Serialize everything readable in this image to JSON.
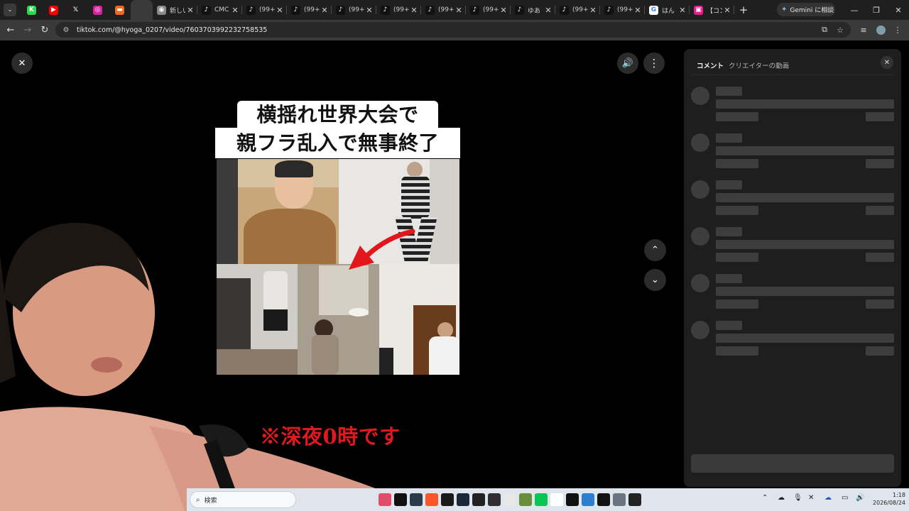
{
  "browser": {
    "url": "tiktok.com/@hyoga_0207/video/7603703992232758535",
    "gemini_label": "Gemini に相談",
    "tabs": [
      {
        "title": "",
        "icon": "k-icon",
        "color": "#2bd94b",
        "kind": "pinned",
        "glyph": "K"
      },
      {
        "title": "",
        "icon": "youtube-icon",
        "color": "#ff0000",
        "kind": "pinned",
        "glyph": "▶"
      },
      {
        "title": "",
        "icon": "x-icon",
        "color": "#1f1f1f",
        "kind": "pinned",
        "glyph": "𝕏"
      },
      {
        "title": "",
        "icon": "instagram-icon",
        "color": "#d6249f",
        "kind": "pinned",
        "glyph": "◎"
      },
      {
        "title": "",
        "icon": "orange-app-icon",
        "color": "#f26b1d",
        "kind": "pinned",
        "glyph": "▬"
      },
      {
        "title": "",
        "icon": "blank-tab-icon",
        "color": "#3a3a3a",
        "kind": "active",
        "glyph": ""
      },
      {
        "title": "新しい",
        "icon": "chrome-icon",
        "color": "#888888",
        "kind": "normal",
        "glyph": "◉"
      },
      {
        "title": "CMC",
        "icon": "tiktok-icon",
        "color": "#111111",
        "kind": "normal",
        "glyph": "♪"
      },
      {
        "title": "(99+",
        "icon": "tiktok-icon",
        "color": "#111111",
        "kind": "normal",
        "glyph": "♪"
      },
      {
        "title": "(99+",
        "icon": "tiktok-icon",
        "color": "#111111",
        "kind": "normal",
        "glyph": "♪"
      },
      {
        "title": "(99+",
        "icon": "tiktok-icon",
        "color": "#111111",
        "kind": "normal",
        "glyph": "♪"
      },
      {
        "title": "(99+",
        "icon": "tiktok-icon",
        "color": "#111111",
        "kind": "normal",
        "glyph": "♪"
      },
      {
        "title": "(99+",
        "icon": "tiktok-icon",
        "color": "#111111",
        "kind": "normal",
        "glyph": "♪"
      },
      {
        "title": "(99+",
        "icon": "tiktok-icon",
        "color": "#111111",
        "kind": "normal",
        "glyph": "♪"
      },
      {
        "title": "ゆあ",
        "icon": "tiktok-icon",
        "color": "#111111",
        "kind": "normal",
        "glyph": "♪"
      },
      {
        "title": "(99+",
        "icon": "tiktok-icon",
        "color": "#111111",
        "kind": "normal",
        "glyph": "♪"
      },
      {
        "title": "(99+",
        "icon": "tiktok-icon",
        "color": "#111111",
        "kind": "normal",
        "glyph": "♪"
      },
      {
        "title": "はん",
        "icon": "google-icon",
        "color": "#ffffff",
        "kind": "normal",
        "glyph": "G"
      },
      {
        "title": "【コン",
        "icon": "niconico-icon",
        "color": "#e01f8c",
        "kind": "normal",
        "glyph": "▣"
      }
    ]
  },
  "video": {
    "caption_line1": "横揺れ世界大会で",
    "caption_line2": "親フラ乱入で無事終了"
  },
  "comments_panel": {
    "tab_comments": "コメント",
    "tab_creator_videos": "クリエイターの動画",
    "skeleton_rows": 6
  },
  "overlay": {
    "text": "※深夜0時です"
  },
  "taskbar": {
    "search_placeholder": "検索",
    "time": "1:18",
    "date": "2026/08/24",
    "apps": [
      {
        "icon": "red-app-icon",
        "color": "#e34b6b"
      },
      {
        "icon": "tiktok-icon",
        "color": "#111111"
      },
      {
        "icon": "davinci-resolve-icon",
        "color": "#2a3b4a"
      },
      {
        "icon": "brave-icon",
        "color": "#fb542b"
      },
      {
        "icon": "green-arrow-icon",
        "color": "#1a1a1a"
      },
      {
        "icon": "steam-icon",
        "color": "#1b2838"
      },
      {
        "icon": "unity-icon",
        "color": "#222222"
      },
      {
        "icon": "obs-icon",
        "color": "#302e31"
      },
      {
        "icon": "calendar-app-icon",
        "color": "#e8e8e8"
      },
      {
        "icon": "minecraft-icon",
        "color": "#6a8f3a"
      },
      {
        "icon": "line-icon",
        "color": "#06c755"
      },
      {
        "icon": "badge-app-icon",
        "color": "#ffffff"
      },
      {
        "icon": "unreal-icon",
        "color": "#111111"
      },
      {
        "icon": "photos-icon",
        "color": "#2d7dd2"
      },
      {
        "icon": "dark-app-icon",
        "color": "#121212"
      },
      {
        "icon": "settings-icon",
        "color": "#6b7280"
      },
      {
        "icon": "media-player-icon",
        "color": "#222222"
      }
    ]
  },
  "colors": {
    "overlay_red": "#e0181f",
    "video_arrow_red": "#e3161c",
    "panel_bg": "#1e1e1e",
    "skeleton": "#3d3d3d"
  }
}
